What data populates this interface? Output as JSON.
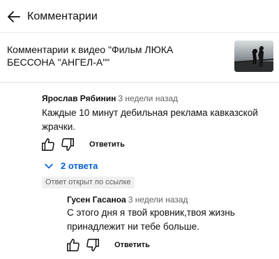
{
  "header": {
    "title": "Комментарии",
    "back_icon": "arrow-left-icon"
  },
  "video": {
    "title": "Комментарии к видео \"Фильм ЛЮКА БЕССОНА \"АНГЕЛ-А\"\""
  },
  "comment": {
    "author": "Ярослав Рябинин",
    "time": "3 недели назад",
    "text": "Каждые 10 минут дебильная реклама кавказской жрачки.",
    "like_icon": "thumb-up-icon",
    "dislike_icon": "thumb-down-icon",
    "reply_label": "Ответить"
  },
  "replies_toggle": {
    "label": "2 ответа",
    "icon": "chevron-down-icon"
  },
  "link_badge": "Ответ открыт по ссылке",
  "reply": {
    "author": "Гусен Гасаноа",
    "time": "3 недели назад",
    "text": "С этого дня я твой кровник,твоя жизнь принадлежит ни тебе больше.",
    "like_icon": "thumb-up-icon",
    "dislike_icon": "thumb-down-icon",
    "reply_label": "Ответить"
  },
  "colors": {
    "link_blue": "#065fd4",
    "text_primary": "#0f0f0f",
    "text_secondary": "#606060",
    "badge_bg": "#f0f0f0"
  }
}
